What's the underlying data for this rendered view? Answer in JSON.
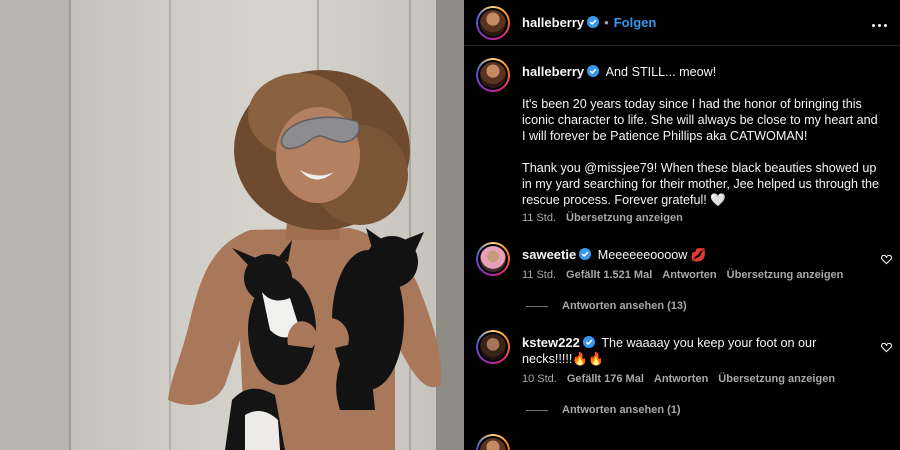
{
  "post": {
    "username": "halleberry",
    "follow_label": "Folgen",
    "separator": "•",
    "caption": {
      "line1": "And STILL... meow!",
      "para1": "It's been 20 years today since I had the honor of bringing this iconic character to life. She will always be close to my heart and I will forever be Patience Phillips aka CATWOMAN!",
      "para2": "Thank you @missjee79! When these black beauties showed up in my yard searching for their mother, Jee helped us through the rescue process. Forever grateful! 🤍",
      "time": "11 Std.",
      "translate": "Übersetzung anzeigen"
    }
  },
  "comments": [
    {
      "username": "saweetie",
      "text": "Meeeeeeoooow 💋",
      "time": "11 Std.",
      "likes": "Gefällt 1.521 Mal",
      "reply": "Antworten",
      "translate": "Übersetzung anzeigen",
      "view_replies": "Antworten ansehen (13)"
    },
    {
      "username": "kstew222",
      "text": "The waaaay you keep your foot on our necks!!!!!🔥🔥",
      "time": "10 Std.",
      "likes": "Gefällt 176 Mal",
      "reply": "Antworten",
      "translate": "Übersetzung anzeigen",
      "view_replies": "Antworten ansehen (1)"
    }
  ],
  "colors": {
    "accent": "#3897f0",
    "verified": "#3897f0",
    "muted": "#a8a8a8",
    "background": "#000000"
  },
  "icons": {
    "more": "more-options-icon",
    "verified": "verified-badge-icon",
    "heart": "heart-icon"
  }
}
